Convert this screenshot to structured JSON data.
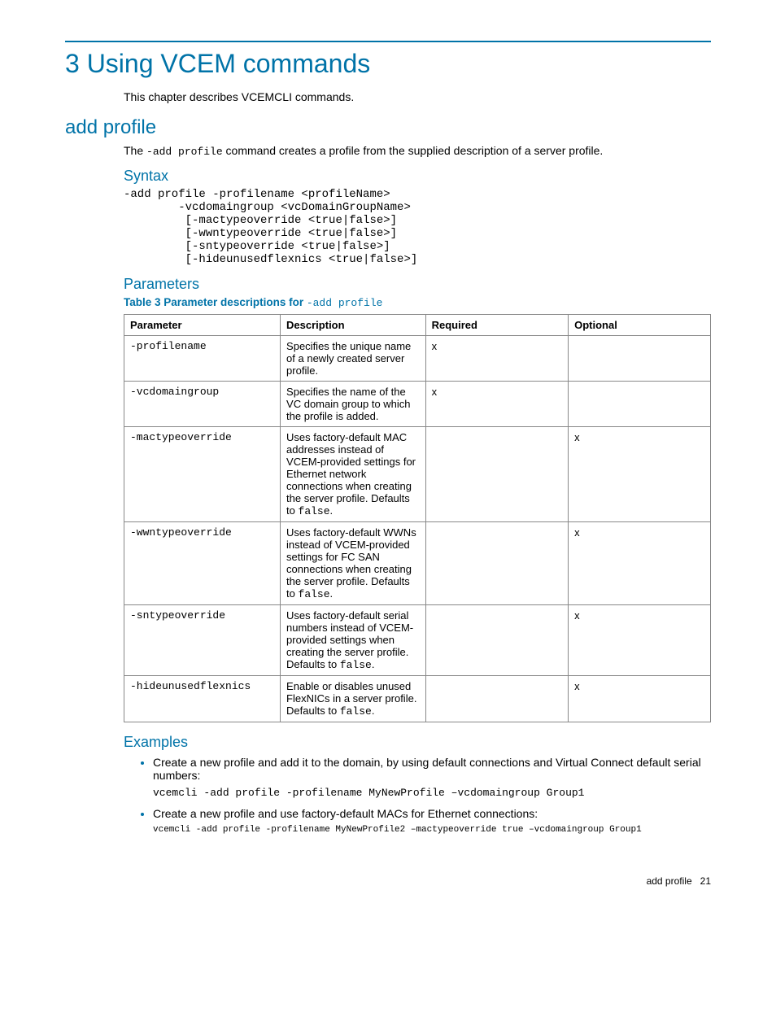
{
  "chapter": {
    "title": "3 Using VCEM commands",
    "intro": "This chapter describes VCEMCLI commands."
  },
  "section": {
    "title": "add profile",
    "desc_pre": "The ",
    "desc_code": "-add profile",
    "desc_post": " command creates a profile from the supplied description of a server profile."
  },
  "syntax": {
    "heading": "Syntax",
    "code": "-add profile -profilename <profileName>\n        -vcdomaingroup <vcDomainGroupName>\n         [-mactypeoverride <true|false>]\n         [-wwntypeoverride <true|false>]\n         [-sntypeoverride <true|false>]\n         [-hideunusedflexnics <true|false>]"
  },
  "parameters": {
    "heading": "Parameters",
    "table_caption_pre": "Table 3 Parameter descriptions for ",
    "table_caption_code": "-add profile",
    "headers": {
      "c0": "Parameter",
      "c1": "Description",
      "c2": "Required",
      "c3": "Optional"
    },
    "rows": [
      {
        "param": "-profilename",
        "desc": "Specifies the unique name of a newly created server profile.",
        "required": "x",
        "optional": ""
      },
      {
        "param": "-vcdomaingroup",
        "desc": "Specifies the name of the VC domain group to which the profile is added.",
        "required": "x",
        "optional": ""
      },
      {
        "param": "-mactypeoverride",
        "desc_pre": "Uses factory-default MAC addresses instead of VCEM-provided settings for Ethernet network connections when creating the server profile. Defaults to ",
        "desc_code": "false",
        "desc_post": ".",
        "required": "",
        "optional": "x"
      },
      {
        "param": "-wwntypeoverride",
        "desc_pre": "Uses factory-default WWNs instead of VCEM-provided settings for FC SAN connections when creating the server profile. Defaults to ",
        "desc_code": "false",
        "desc_post": ".",
        "required": "",
        "optional": "x"
      },
      {
        "param": "-sntypeoverride",
        "desc_pre": "Uses factory-default serial numbers instead of VCEM-provided settings when creating the server profile. Defaults to ",
        "desc_code": "false",
        "desc_post": ".",
        "required": "",
        "optional": "x"
      },
      {
        "param": "-hideunusedflexnics",
        "desc_pre": "Enable or disables unused FlexNICs in a server profile. Defaults to ",
        "desc_code": "false",
        "desc_post": ".",
        "required": "",
        "optional": "x"
      }
    ]
  },
  "examples": {
    "heading": "Examples",
    "items": [
      {
        "text": "Create a new profile and add it to the domain, by using default connections and Virtual Connect default serial numbers:",
        "code": "vcemcli -add profile -profilename MyNewProfile –vcdomaingroup Group1",
        "small": false
      },
      {
        "text": "Create a new profile and use factory-default MACs for Ethernet connections:",
        "code": "vcemcli -add profile -profilename MyNewProfile2 –mactypeoverride true –vcdomaingroup Group1",
        "small": true
      }
    ]
  },
  "footer": {
    "label": "add profile",
    "page": "21"
  }
}
